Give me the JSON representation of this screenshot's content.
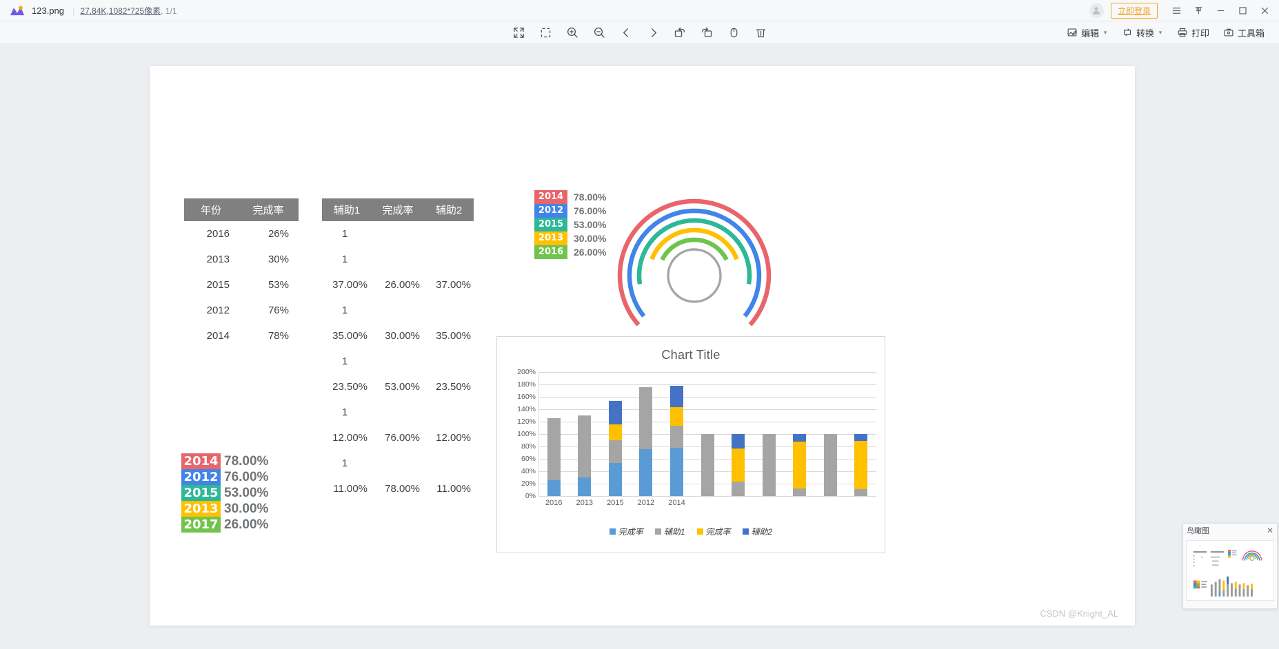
{
  "titlebar": {
    "file_name": "123.png",
    "size": "27.84K",
    "dimensions": ",1082*725像素",
    "page_count": ", 1/1",
    "login_label": "立即登录",
    "icons": {
      "avatar": "user-avatar-icon",
      "menu": "hamburger-menu-icon",
      "pin": "pin-icon",
      "minimize": "minimize-icon",
      "maximize": "maximize-icon",
      "close": "close-icon"
    }
  },
  "toolbar": {
    "center_icons": [
      "fullscreen-icon",
      "crop-icon",
      "zoom-in-icon",
      "zoom-out-icon",
      "previous-icon",
      "next-icon",
      "rotate-left-icon",
      "rotate-right-icon",
      "mouse-icon",
      "delete-icon"
    ],
    "right_items": [
      {
        "label": "编辑",
        "icon": "edit-image-icon",
        "caret": "▼"
      },
      {
        "label": "转换",
        "icon": "convert-icon",
        "caret": "▼"
      },
      {
        "label": "打印",
        "icon": "print-icon",
        "caret": ""
      },
      {
        "label": "工具箱",
        "icon": "toolbox-icon",
        "caret": ""
      }
    ]
  },
  "document": {
    "table1": {
      "headers": [
        "年份",
        "完成率"
      ],
      "rows": [
        [
          "2016",
          "26%"
        ],
        [
          "2013",
          "30%"
        ],
        [
          "2015",
          "53%"
        ],
        [
          "2012",
          "76%"
        ],
        [
          "2014",
          "78%"
        ]
      ]
    },
    "table2": {
      "headers": [
        "辅助1",
        "完成率",
        "辅助2"
      ],
      "rows": [
        [
          "1",
          "",
          ""
        ],
        [
          "1",
          "",
          ""
        ],
        [
          "37.00%",
          "26.00%",
          "37.00%"
        ],
        [
          "1",
          "",
          ""
        ],
        [
          "35.00%",
          "30.00%",
          "35.00%"
        ],
        [
          "1",
          "",
          ""
        ],
        [
          "23.50%",
          "53.00%",
          "23.50%"
        ],
        [
          "1",
          "",
          ""
        ],
        [
          "12.00%",
          "76.00%",
          "12.00%"
        ],
        [
          "1",
          "",
          ""
        ],
        [
          "11.00%",
          "78.00%",
          "11.00%"
        ]
      ]
    },
    "legend_big": [
      {
        "year": "2014",
        "value": "78.00%",
        "color": "#e8656b"
      },
      {
        "year": "2012",
        "value": "76.00%",
        "color": "#4285e8"
      },
      {
        "year": "2015",
        "value": "53.00%",
        "color": "#2db897"
      },
      {
        "year": "2013",
        "value": "30.00%",
        "color": "#ffc000"
      },
      {
        "year": "2017",
        "value": "26.00%",
        "color": "#70c44c"
      }
    ],
    "legend_small": [
      {
        "year": "2014",
        "value": "78.00%",
        "color": "#e8656b"
      },
      {
        "year": "2012",
        "value": "76.00%",
        "color": "#4285e8"
      },
      {
        "year": "2015",
        "value": "53.00%",
        "color": "#2db897"
      },
      {
        "year": "2013",
        "value": "30.00%",
        "color": "#ffc000"
      },
      {
        "year": "2016",
        "value": "26.00%",
        "color": "#70c44c"
      }
    ],
    "watermark": "CSDN @Knight_AL"
  },
  "chart_data": [
    {
      "type": "pie",
      "name": "radial-gauge",
      "title": "",
      "series": [
        {
          "name": "2014",
          "value": 78.0,
          "color": "#e8656b",
          "radius": 108
        },
        {
          "name": "2012",
          "value": 76.0,
          "color": "#4285e8",
          "radius": 94
        },
        {
          "name": "2015",
          "value": 53.0,
          "color": "#2db897",
          "radius": 80
        },
        {
          "name": "2013",
          "value": 30.0,
          "color": "#ffc000",
          "radius": 66
        },
        {
          "name": "2017",
          "value": 26.0,
          "color": "#70c44c",
          "radius": 52
        }
      ],
      "track": {
        "color": "#a6a6a6",
        "radius": 38
      }
    },
    {
      "type": "bar",
      "name": "stacked-bar-chart",
      "title": "Chart Title",
      "stacked": true,
      "categories": [
        "2016",
        "2013",
        "2015",
        "2012",
        "2014",
        "",
        "",
        "",
        "",
        "",
        ""
      ],
      "series": [
        {
          "name": "完成率",
          "color": "#5b9bd5",
          "values": [
            26,
            30,
            53,
            76,
            78,
            0,
            0,
            0,
            0,
            0,
            0
          ]
        },
        {
          "name": "辅助1",
          "color": "#a5a5a5",
          "values": [
            100,
            100,
            37,
            100,
            35,
            100,
            23.5,
            100,
            12,
            100,
            11
          ]
        },
        {
          "name": "完成率",
          "color": "#ffc000",
          "values": [
            0,
            0,
            26,
            0,
            30,
            0,
            53,
            0,
            76,
            0,
            78
          ]
        },
        {
          "name": "辅助2",
          "color": "#4472c4",
          "values": [
            0,
            0,
            37,
            0,
            35,
            0,
            23.5,
            0,
            12,
            0,
            11
          ]
        }
      ],
      "ylabel": "",
      "xlabel": "",
      "ylim": [
        0,
        200
      ],
      "yticks": [
        "200%",
        "180%",
        "160%",
        "140%",
        "120%",
        "100%",
        "80%",
        "60%",
        "40%",
        "20%",
        "0%"
      ],
      "grid": true,
      "legend_position": "bottom"
    }
  ],
  "overview": {
    "title": "鸟瞰图",
    "close_icon": "close-icon"
  }
}
